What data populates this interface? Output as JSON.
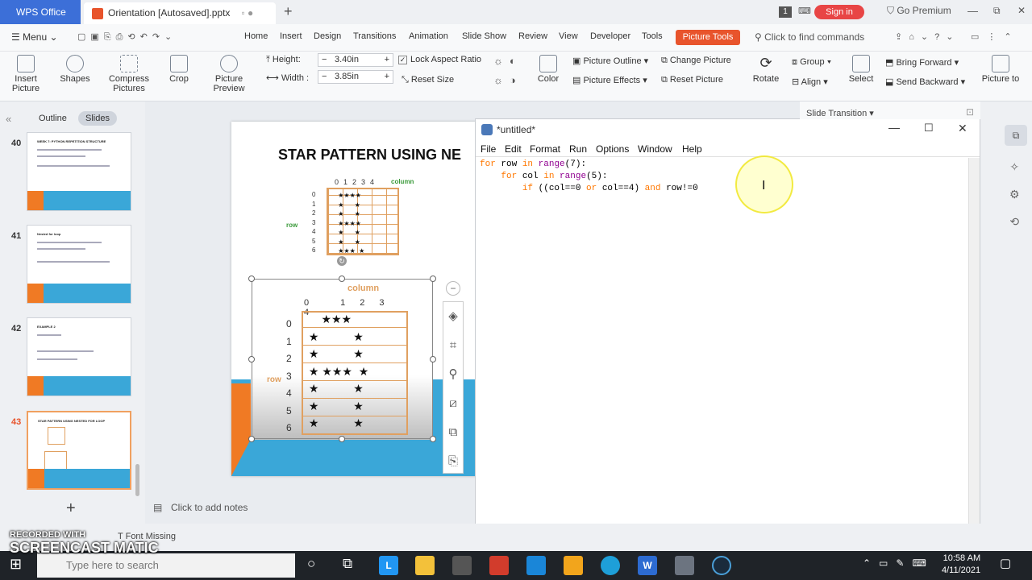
{
  "titlebar": {
    "app_tab": "WPS Office",
    "doc_tab": "Orientation [Autosaved].pptx",
    "badge": "1",
    "sign_in": "Sign in",
    "go_premium": "Go Premium"
  },
  "menubar": {
    "menu": "Menu",
    "items": [
      "Home",
      "Insert",
      "Design",
      "Transitions",
      "Animation",
      "Slide Show",
      "Review",
      "View",
      "Developer",
      "Tools"
    ],
    "active_tab": "Picture Tools",
    "search_placeholder": "Click to find commands"
  },
  "ribbon": {
    "insert_picture": "Insert Picture",
    "shapes": "Shapes",
    "compress": "Compress Pictures",
    "crop": "Crop",
    "picture_preview": "Picture Preview",
    "height_label": "Height:",
    "height_value": "3.40in",
    "width_label": "Width :",
    "width_value": "3.85in",
    "lock_aspect": "Lock Aspect Ratio",
    "reset_size": "Reset Size",
    "color": "Color",
    "picture_outline": "Picture Outline",
    "picture_effects": "Picture Effects",
    "change_picture": "Change Picture",
    "reset_picture": "Reset Picture",
    "rotate": "Rotate",
    "group": "Group",
    "align": "Align",
    "select": "Select",
    "bring_forward": "Bring Forward",
    "send_backward": "Send Backward",
    "picture_to": "Picture to"
  },
  "left_panel": {
    "tab_outline": "Outline",
    "tab_slides": "Slides",
    "slides": [
      {
        "num": "40",
        "title": "WEEK 7: PYTHON REPETITION STRUCTURE"
      },
      {
        "num": "41",
        "title": "Nested for loop"
      },
      {
        "num": "42",
        "title": "EXAMPLE 2"
      },
      {
        "num": "43",
        "title": "STAR PATTERN USING NESTED FOR LOOP"
      }
    ]
  },
  "slide": {
    "title": "STAR PATTERN USING NE",
    "col_label": "column",
    "row_label": "row",
    "col_numbers": [
      "0",
      "1",
      "2",
      "3",
      "4"
    ],
    "row_numbers": [
      "0",
      "1",
      "2",
      "3",
      "4",
      "5",
      "6"
    ]
  },
  "idle": {
    "title": "*untitled*",
    "menu": [
      "File",
      "Edit",
      "Format",
      "Run",
      "Options",
      "Window",
      "Help"
    ],
    "code": [
      [
        {
          "t": "for",
          "c": "kw"
        },
        {
          "t": " row ",
          "c": ""
        },
        {
          "t": "in",
          "c": "kw"
        },
        {
          "t": " ",
          "c": ""
        },
        {
          "t": "range",
          "c": "bi"
        },
        {
          "t": "(7):",
          "c": ""
        }
      ],
      [
        {
          "t": "    ",
          "c": ""
        },
        {
          "t": "for",
          "c": "kw"
        },
        {
          "t": " col ",
          "c": ""
        },
        {
          "t": "in",
          "c": "kw"
        },
        {
          "t": " ",
          "c": ""
        },
        {
          "t": "range",
          "c": "bi"
        },
        {
          "t": "(5):",
          "c": ""
        }
      ],
      [
        {
          "t": "        ",
          "c": ""
        },
        {
          "t": "if",
          "c": "kw"
        },
        {
          "t": " ((col==0 ",
          "c": ""
        },
        {
          "t": "or",
          "c": "kw"
        },
        {
          "t": " col==4) ",
          "c": ""
        },
        {
          "t": "and",
          "c": "kw"
        },
        {
          "t": " row!=0",
          "c": ""
        }
      ]
    ]
  },
  "right_panel": {
    "slide_transition": "Slide Transition"
  },
  "notes": {
    "placeholder": "Click to add notes"
  },
  "status": {
    "font_missing": "Font Missing",
    "recorded": "RECORDED WITH",
    "brand": "SCREENCAST  MATIC"
  },
  "taskbar": {
    "search_placeholder": "Type here to search",
    "time": "10:58 AM",
    "date": "4/11/2021"
  },
  "colors": {
    "accent_wps": "#3c6fd8",
    "accent_pp": "#e8542c",
    "slide_blue": "#3aa7d8",
    "slide_orange": "#f07a24"
  }
}
